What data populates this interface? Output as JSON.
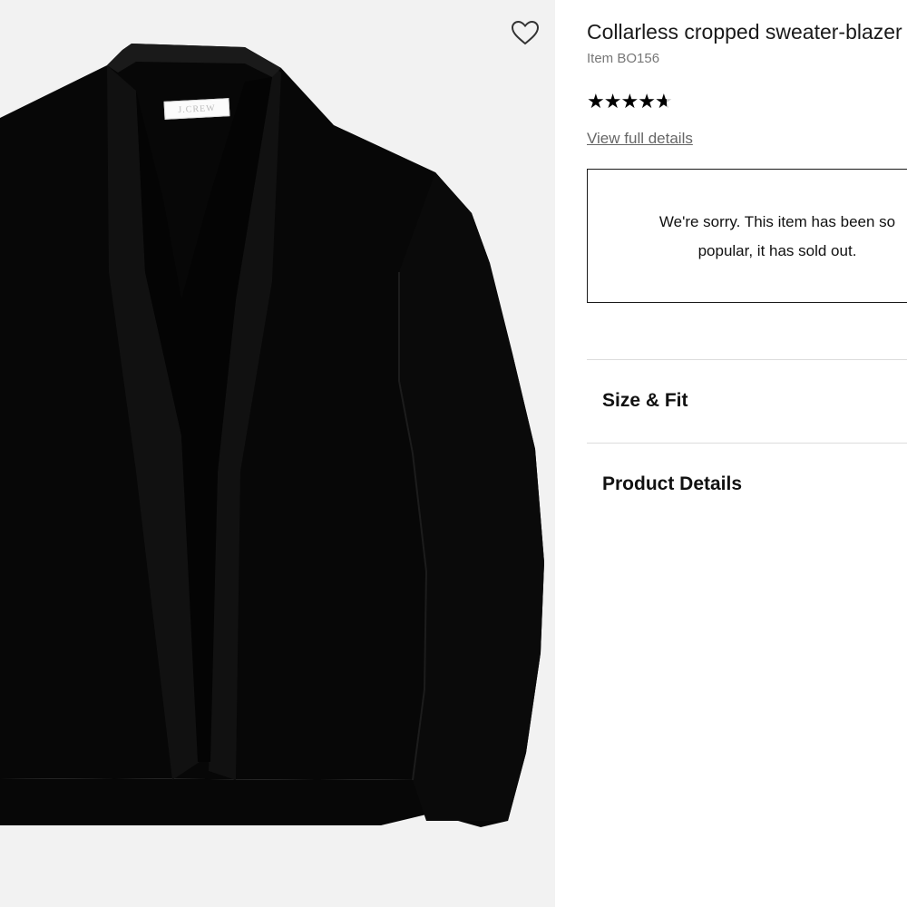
{
  "product": {
    "brand_tag": "J.CREW",
    "title": "Collarless cropped sweater-blazer",
    "item_code": "Item BO156",
    "rating": 4.7,
    "rating_max": 5,
    "view_details_link": "View full details"
  },
  "availability": {
    "line1": "We're sorry. This item has been so",
    "line2": "popular, it has sold out."
  },
  "accordion": {
    "size_fit": "Size & Fit",
    "product_details": "Product Details"
  },
  "icons": {
    "favorite": "heart-outline-icon",
    "star": "star-icon"
  },
  "colors": {
    "garment": "#070707",
    "background": "#f2f2f2",
    "muted_text": "#777777"
  }
}
